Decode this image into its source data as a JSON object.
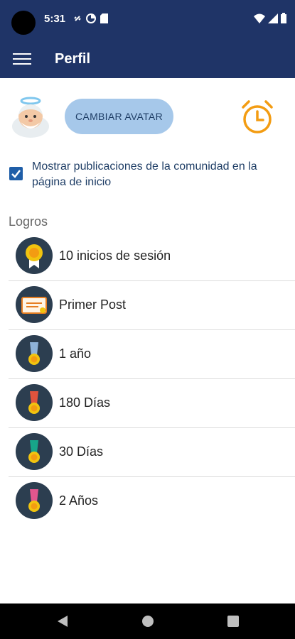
{
  "status_bar": {
    "time": "5:31",
    "icons": [
      "link-icon",
      "data-saver-icon",
      "sd-card-icon"
    ],
    "right_icons": [
      "wifi-icon",
      "signal-icon",
      "battery-icon"
    ]
  },
  "app_bar": {
    "title": "Perfil",
    "menu_icon": "hamburger-menu-icon"
  },
  "profile": {
    "avatar": "angel-avatar",
    "change_avatar_label": "CAMBIAR AVATAR",
    "alarm_icon": "alarm-clock-icon"
  },
  "settings": {
    "show_community_label": "Mostrar publicaciones de la comunidad en la página de inicio",
    "show_community_checked": true
  },
  "achievements": {
    "title": "Logros",
    "items": [
      {
        "label": "10 inicios de sesión",
        "icon": "award-ribbon-icon"
      },
      {
        "label": "Primer Post",
        "icon": "certificate-icon"
      },
      {
        "label": "1 año",
        "icon": "medal-blue-icon",
        "ribbon": "#8fb3d9"
      },
      {
        "label": "180 Días",
        "icon": "medal-red-icon",
        "ribbon": "#e0533d"
      },
      {
        "label": "30 Días",
        "icon": "medal-teal-icon",
        "ribbon": "#17a589"
      },
      {
        "label": "2 Años",
        "icon": "medal-pink-icon",
        "ribbon": "#e2568e"
      }
    ]
  },
  "colors": {
    "primary": "#1f3467",
    "button_bg": "#a6c8ea",
    "alarm": "#f39c12",
    "badge_bg": "#2c3e50"
  }
}
